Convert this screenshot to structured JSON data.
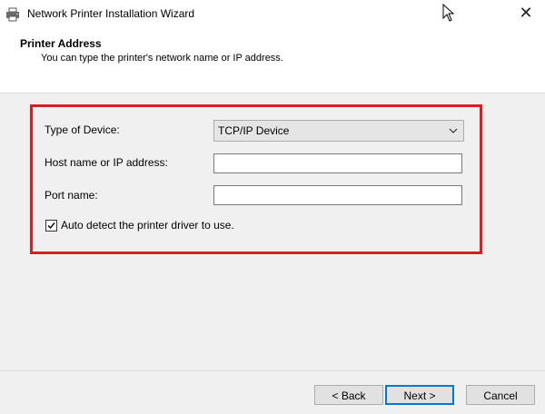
{
  "window": {
    "title": "Network Printer Installation Wizard",
    "icon": "printer-icon",
    "close_glyph": "✕"
  },
  "header": {
    "title": "Printer Address",
    "subtitle": "You can type the printer's network name or IP address."
  },
  "form": {
    "device_type_label": "Type of Device:",
    "device_type_value": "TCP/IP Device",
    "host_label": "Host name or IP address:",
    "host_value": "",
    "port_label": "Port name:",
    "port_value": "",
    "auto_detect_label": "Auto detect the printer driver to use.",
    "auto_detect_checked": true
  },
  "buttons": {
    "back": "< Back",
    "next": "Next >",
    "cancel": "Cancel"
  },
  "colors": {
    "highlight": "#d91f26",
    "accent": "#0078d7"
  }
}
